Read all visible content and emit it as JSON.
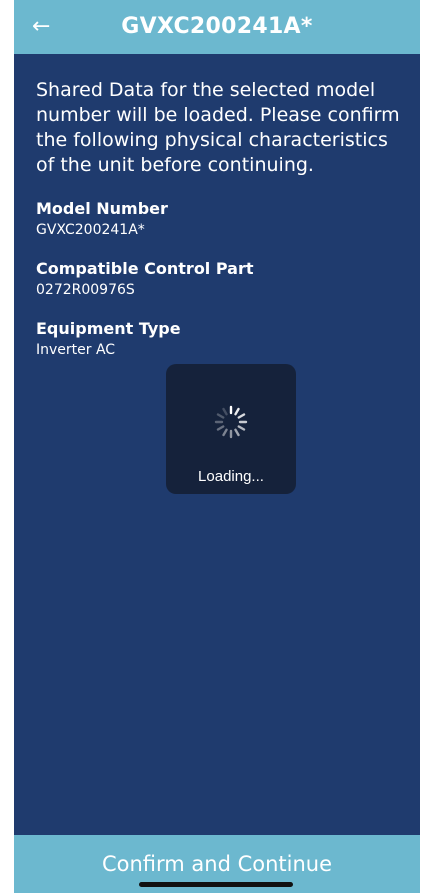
{
  "header": {
    "title": "GVXC200241A*"
  },
  "intro": {
    "text": "Shared Data for the selected model number will be loaded. Please confirm the following physical characteristics of the unit before continuing."
  },
  "fields": {
    "model_number": {
      "label": "Model Number",
      "value": "GVXC200241A*"
    },
    "control_part": {
      "label": "Compatible Control Part",
      "value": "0272R00976S"
    },
    "equipment_type": {
      "label": "Equipment Type",
      "value": "Inverter AC"
    }
  },
  "loading": {
    "text": "Loading..."
  },
  "footer": {
    "confirm_label": "Confirm and Continue"
  },
  "colors": {
    "background": "#1f3b6e",
    "accent": "#6cb8cf",
    "text": "#ffffff"
  }
}
